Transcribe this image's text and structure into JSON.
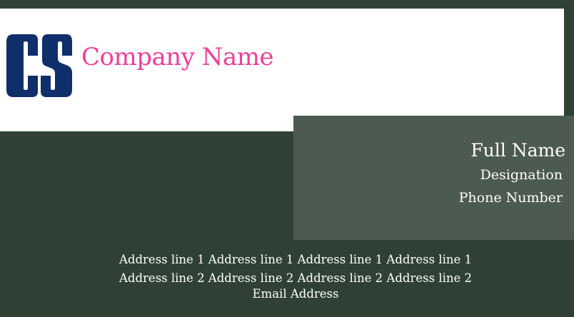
{
  "card": {
    "company_name": "Company Name",
    "logo_icon": "cs-monogram-logo",
    "full_name": "Full Name",
    "designation": "Designation",
    "phone": "Phone Number",
    "address_line_1": "Address line 1 Address line 1 Address line 1 Address line 1",
    "address_line_2": "Address line 2 Address line 2 Address line 2 Address line 2",
    "email": "Email Address"
  },
  "colors": {
    "background": "#2e4134",
    "panel": "#4d5a4f",
    "header_band": "#ffffff",
    "brand_pink": "#ee3f9a",
    "logo_navy": "#0f2f6b"
  }
}
